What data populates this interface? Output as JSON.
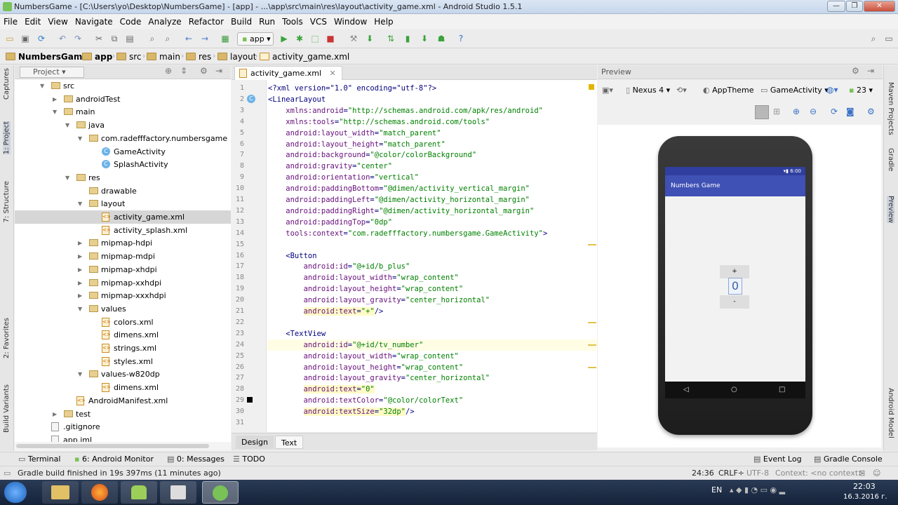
{
  "window": {
    "title": "NumbersGame - [C:\\Users\\yo\\Desktop\\NumbersGame] - [app] - ...\\app\\src\\main\\res\\layout\\activity_game.xml - Android Studio 1.5.1",
    "min": "—",
    "max": "❐",
    "close": "✕"
  },
  "menu": [
    "File",
    "Edit",
    "View",
    "Navigate",
    "Code",
    "Analyze",
    "Refactor",
    "Build",
    "Run",
    "Tools",
    "VCS",
    "Window",
    "Help"
  ],
  "toolbar": {
    "run_config": "app"
  },
  "breadcrumbs": [
    "NumbersGame",
    "app",
    "src",
    "main",
    "res",
    "layout",
    "activity_game.xml"
  ],
  "left_strip": {
    "captures": "Captures",
    "project": "1: Project",
    "structure": "7: Structure",
    "favorites": "2: Favorites",
    "build_variants": "Build Variants"
  },
  "right_strip": {
    "maven": "Maven Projects",
    "gradle": "Gradle",
    "preview": "Preview",
    "android_model": "Android Model"
  },
  "project_panel": {
    "title": "Project"
  },
  "tree": [
    {
      "label": "src",
      "type": "folder",
      "depth": 1,
      "open": true
    },
    {
      "label": "androidTest",
      "type": "folder",
      "depth": 2,
      "open": false
    },
    {
      "label": "main",
      "type": "folder",
      "depth": 2,
      "open": true
    },
    {
      "label": "java",
      "type": "folder",
      "depth": 3,
      "open": true
    },
    {
      "label": "com.radefffactory.numbersgame",
      "type": "folder",
      "depth": 4,
      "open": true
    },
    {
      "label": "GameActivity",
      "type": "class",
      "depth": 5
    },
    {
      "label": "SplashActivity",
      "type": "class",
      "depth": 5
    },
    {
      "label": "res",
      "type": "folder",
      "depth": 3,
      "open": true
    },
    {
      "label": "drawable",
      "type": "folder",
      "depth": 4,
      "leaf": true
    },
    {
      "label": "layout",
      "type": "folder",
      "depth": 4,
      "open": true
    },
    {
      "label": "activity_game.xml",
      "type": "xml",
      "depth": 5,
      "selected": true
    },
    {
      "label": "activity_splash.xml",
      "type": "xml",
      "depth": 5
    },
    {
      "label": "mipmap-hdpi",
      "type": "folder",
      "depth": 4,
      "open": false
    },
    {
      "label": "mipmap-mdpi",
      "type": "folder",
      "depth": 4,
      "open": false
    },
    {
      "label": "mipmap-xhdpi",
      "type": "folder",
      "depth": 4,
      "open": false
    },
    {
      "label": "mipmap-xxhdpi",
      "type": "folder",
      "depth": 4,
      "open": false
    },
    {
      "label": "mipmap-xxxhdpi",
      "type": "folder",
      "depth": 4,
      "open": false
    },
    {
      "label": "values",
      "type": "folder",
      "depth": 4,
      "open": true
    },
    {
      "label": "colors.xml",
      "type": "xml",
      "depth": 5
    },
    {
      "label": "dimens.xml",
      "type": "xml",
      "depth": 5
    },
    {
      "label": "strings.xml",
      "type": "xml",
      "depth": 5
    },
    {
      "label": "styles.xml",
      "type": "xml",
      "depth": 5
    },
    {
      "label": "values-w820dp",
      "type": "folder",
      "depth": 4,
      "open": true
    },
    {
      "label": "dimens.xml",
      "type": "xml",
      "depth": 5
    },
    {
      "label": "AndroidManifest.xml",
      "type": "xml",
      "depth": 3
    },
    {
      "label": "test",
      "type": "folder",
      "depth": 2,
      "open": false
    },
    {
      "label": ".gitignore",
      "type": "file",
      "depth": 1
    },
    {
      "label": "app.iml",
      "type": "file",
      "depth": 1
    }
  ],
  "editor": {
    "tab": "activity_game.xml",
    "lines": [
      "<?xml version=\"1.0\" encoding=\"utf-8\"?>",
      "<LinearLayout",
      "    xmlns:android=\"http://schemas.android.com/apk/res/android\"",
      "    xmlns:tools=\"http://schemas.android.com/tools\"",
      "    android:layout_width=\"match_parent\"",
      "    android:layout_height=\"match_parent\"",
      "    android:background=\"@color/colorBackground\"",
      "    android:gravity=\"center\"",
      "    android:orientation=\"vertical\"",
      "    android:paddingBottom=\"@dimen/activity_vertical_margin\"",
      "    android:paddingLeft=\"@dimen/activity_horizontal_margin\"",
      "    android:paddingRight=\"@dimen/activity_horizontal_margin\"",
      "    android:paddingTop=\"0dp\"",
      "    tools:context=\"com.radefffactory.numbersgame.GameActivity\">",
      "",
      "    <Button",
      "        android:id=\"@+id/b_plus\"",
      "        android:layout_width=\"wrap_content\"",
      "        android:layout_height=\"wrap_content\"",
      "        android:layout_gravity=\"center_horizontal\"",
      "        android:text=\"+\"/>",
      "",
      "    <TextView",
      "        android:id=\"@+id/tv_number\"",
      "        android:layout_width=\"wrap_content\"",
      "        android:layout_height=\"wrap_content\"",
      "        android:layout_gravity=\"center_horizontal\"",
      "        android:text=\"0\"",
      "        android:textColor=\"@color/colorText\"",
      "        android:textSize=\"32dp\"/>",
      ""
    ],
    "highlight_lines": [
      21,
      28,
      30
    ],
    "current_line": 24,
    "bottom_tabs": [
      "Design",
      "Text"
    ],
    "active_bottom_tab": "Text"
  },
  "preview": {
    "title": "Preview",
    "device": "Nexus 4",
    "theme": "AppTheme",
    "activity": "GameActivity",
    "api": "23",
    "phone": {
      "status_time": "6:00",
      "app_title": "Numbers Game",
      "plus_label": "+",
      "number": "0",
      "minus_label": "-",
      "accent": "#3f51b5"
    }
  },
  "tool_windows": {
    "terminal": "Terminal",
    "android_monitor": "6: Android Monitor",
    "messages": "0: Messages",
    "todo": "TODO",
    "event_log": "Event Log",
    "gradle_console": "Gradle Console"
  },
  "status": {
    "message": "Gradle build finished in 19s 397ms (11 minutes ago)",
    "position": "24:36",
    "line_sep": "CRLF÷",
    "encoding": "UTF-8",
    "context": "Context: <no context>"
  },
  "taskbar": {
    "lang": "EN",
    "time": "22:03",
    "date": "16.3.2016 г."
  }
}
